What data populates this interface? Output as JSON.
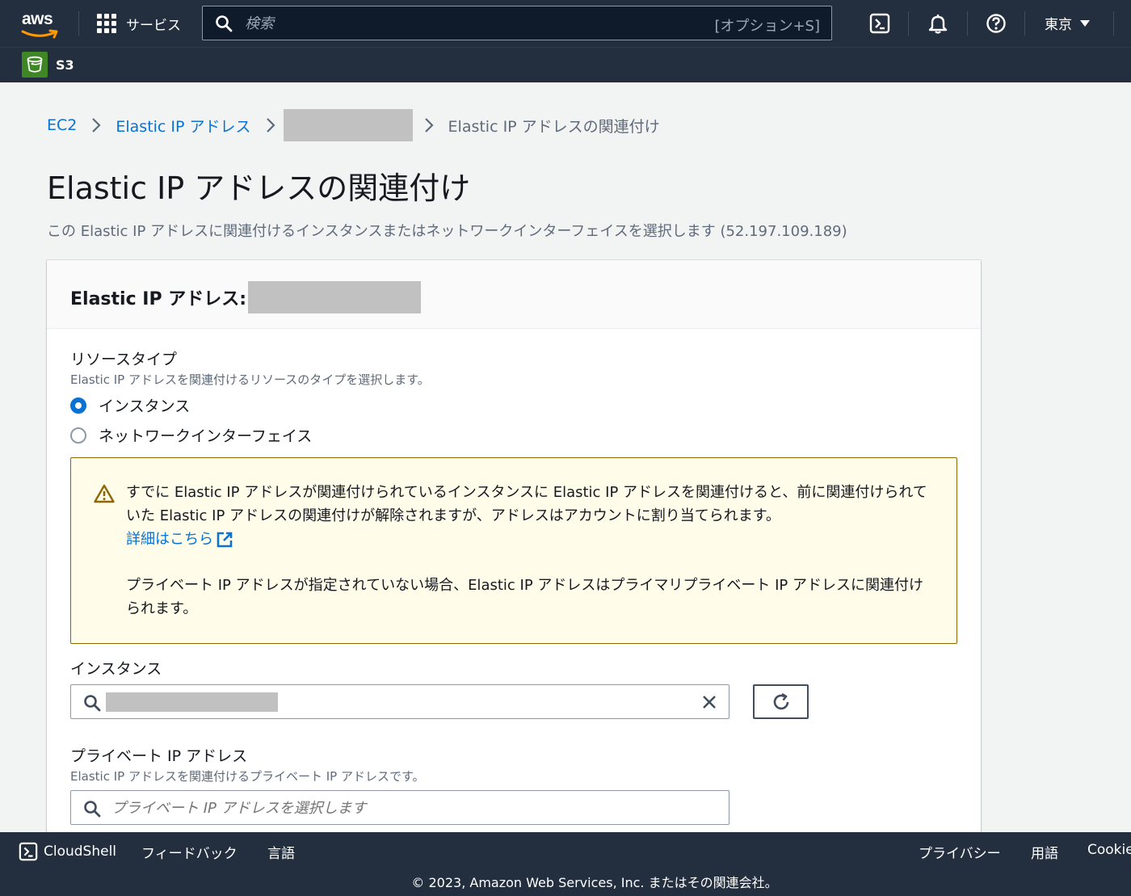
{
  "topnav": {
    "logo_text": "aws",
    "services_label": "サービス",
    "search_placeholder": "検索",
    "search_shortcut": "[オプション+S]",
    "region": "東京"
  },
  "subnav": {
    "service_label": "S3"
  },
  "breadcrumb": {
    "ec2": "EC2",
    "eip": "Elastic IP アドレス",
    "current": "Elastic IP アドレスの関連付け"
  },
  "page": {
    "title": "Elastic IP アドレスの関連付け",
    "description": "この Elastic IP アドレスに関連付けるインスタンスまたはネットワークインターフェイスを選択します (52.197.109.189)"
  },
  "card": {
    "title": "Elastic IP アドレス:",
    "resource_type": {
      "label": "リソースタイプ",
      "hint": "Elastic IP アドレスを関連付けるリソースのタイプを選択します。",
      "options": [
        "インスタンス",
        "ネットワークインターフェイス"
      ],
      "selected": "インスタンス"
    },
    "alert": {
      "line1": "すでに Elastic IP アドレスが関連付けられているインスタンスに Elastic IP アドレスを関連付けると、前に関連付けられていた Elastic IP アドレスの関連付けが解除されますが、アドレスはアカウントに割り当てられます。",
      "link": "詳細はこちら",
      "line2": "プライベート IP アドレスが指定されていない場合、Elastic IP アドレスはプライマリプライベート IP アドレスに関連付けられます。"
    },
    "instance": {
      "label": "インスタンス"
    },
    "private_ip": {
      "label": "プライベート IP アドレス",
      "hint": "Elastic IP アドレスを関連付けるプライベート IP アドレスです。",
      "placeholder": "プライベート IP アドレスを選択します"
    }
  },
  "footer": {
    "cloudshell": "CloudShell",
    "feedback": "フィードバック",
    "language": "言語",
    "privacy": "プライバシー",
    "terms": "用語",
    "cookie": "Cookie",
    "copyright": "© 2023, Amazon Web Services, Inc. またはその関連会社。"
  },
  "colors": {
    "nav_bg": "#232f3e",
    "link": "#0972d3",
    "alert_bg": "#fffce9",
    "alert_border": "#8d6605",
    "s3_green": "#3f8624"
  }
}
